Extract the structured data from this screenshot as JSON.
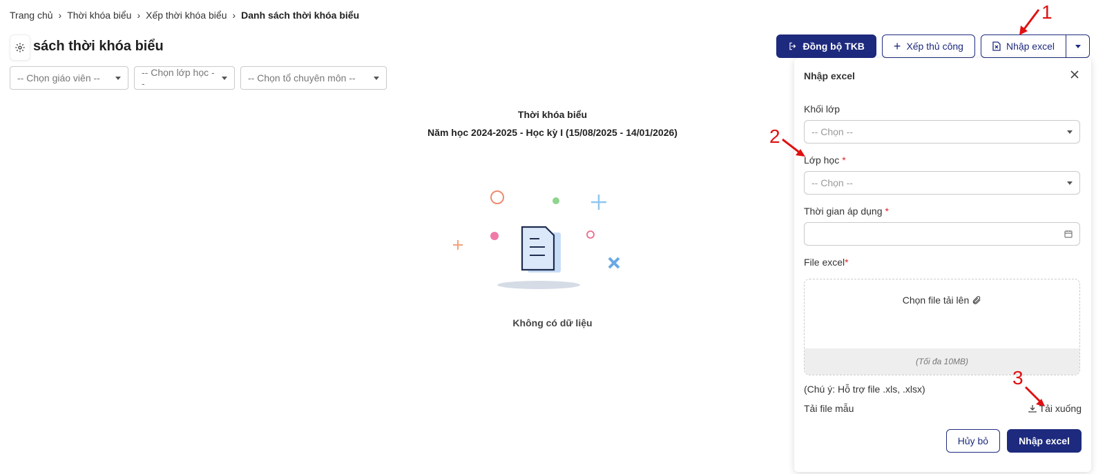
{
  "breadcrumb": {
    "items": [
      "Trang chủ",
      "Thời khóa biểu",
      "Xếp thời khóa biểu"
    ],
    "current": "Danh sách thời khóa biểu"
  },
  "page": {
    "title": "nh sách thời khóa biểu"
  },
  "toolbar": {
    "sync_label": "Đồng bộ TKB",
    "manual_label": "Xếp thủ công",
    "import_label": "Nhập excel"
  },
  "filters": {
    "teacher_placeholder": "-- Chọn giáo viên --",
    "class_placeholder": "-- Chọn lớp học --",
    "department_placeholder": "-- Chọn tổ chuyên môn --"
  },
  "schedule": {
    "heading": "Thời khóa biểu",
    "subheading": "Năm học 2024-2025 - Học kỳ I (15/08/2025 - 14/01/2026)",
    "empty_text": "Không có dữ liệu"
  },
  "import_panel": {
    "title": "Nhập excel",
    "grade_label": "Khối lớp",
    "grade_placeholder": "-- Chọn --",
    "class_label": "Lớp học",
    "class_placeholder": "-- Chọn --",
    "date_label": "Thời gian áp dụng",
    "file_label": "File excel",
    "required_mark": "*",
    "upload_label": "Chọn file tải lên",
    "upload_hint": "(Tối đa 10MB)",
    "note": "(Chú ý: Hỗ trợ file .xls, .xlsx)",
    "sample_label": "Tải file mẫu",
    "download_label": "Tải xuống",
    "cancel_label": "Hủy bỏ",
    "submit_label": "Nhập excel"
  },
  "annotations": [
    "1",
    "2",
    "3"
  ],
  "colors": {
    "primary": "#1d2a7e",
    "annotation": "#e01010",
    "required": "#e02424"
  }
}
